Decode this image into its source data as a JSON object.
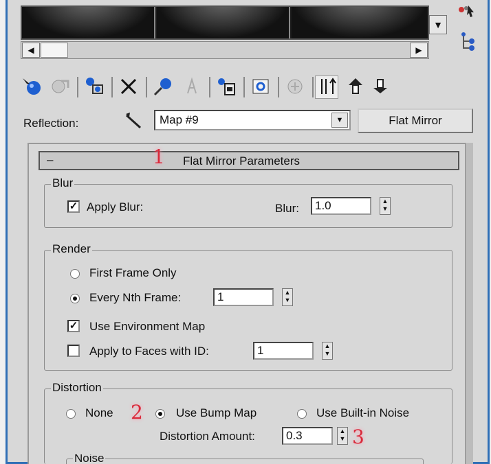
{
  "reflection": {
    "label": "Reflection:",
    "map_value": "Map #9",
    "type_button": "Flat Mirror"
  },
  "rollout": {
    "collapse_symbol": "–",
    "title": "Flat Mirror Parameters"
  },
  "blur": {
    "group_label": "Blur",
    "apply_blur_label": "Apply Blur:",
    "apply_blur_checked": true,
    "blur_label": "Blur:",
    "blur_value": "1.0"
  },
  "render": {
    "group_label": "Render",
    "first_frame_label": "First Frame Only",
    "every_nth_label": "Every Nth Frame:",
    "every_nth_value": "1",
    "selected": "every_nth",
    "use_env_label": "Use Environment Map",
    "use_env_checked": true,
    "apply_faces_label": "Apply to Faces with ID:",
    "apply_faces_checked": false,
    "apply_faces_value": "1"
  },
  "distortion": {
    "group_label": "Distortion",
    "none_label": "None",
    "bump_label": "Use Bump Map",
    "noise_label": "Use Built-in Noise",
    "selected": "bump",
    "amount_label": "Distortion Amount:",
    "amount_value": "0.3"
  },
  "noise_group_label": "Noise",
  "markers": [
    "1",
    "2",
    "3"
  ],
  "symbols": {
    "checkmark": "✓",
    "dropdown": "▼",
    "scroll_left": "◀",
    "scroll_right": "▶",
    "spin_up": "▲",
    "spin_down": "▼"
  },
  "icons": [
    "get-material-icon",
    "put-to-scene-icon",
    "assign-to-selection-icon",
    "delete-icon",
    "make-unique-icon",
    "put-to-library-icon",
    "material-effects-channel-icon",
    "show-map-in-viewport-icon",
    "show-end-result-icon",
    "go-to-parent-icon",
    "go-forward-icon"
  ],
  "colors": {
    "frame": "#2f6fb6",
    "marker": "#d9293a",
    "panel": "#d8d8d8"
  }
}
